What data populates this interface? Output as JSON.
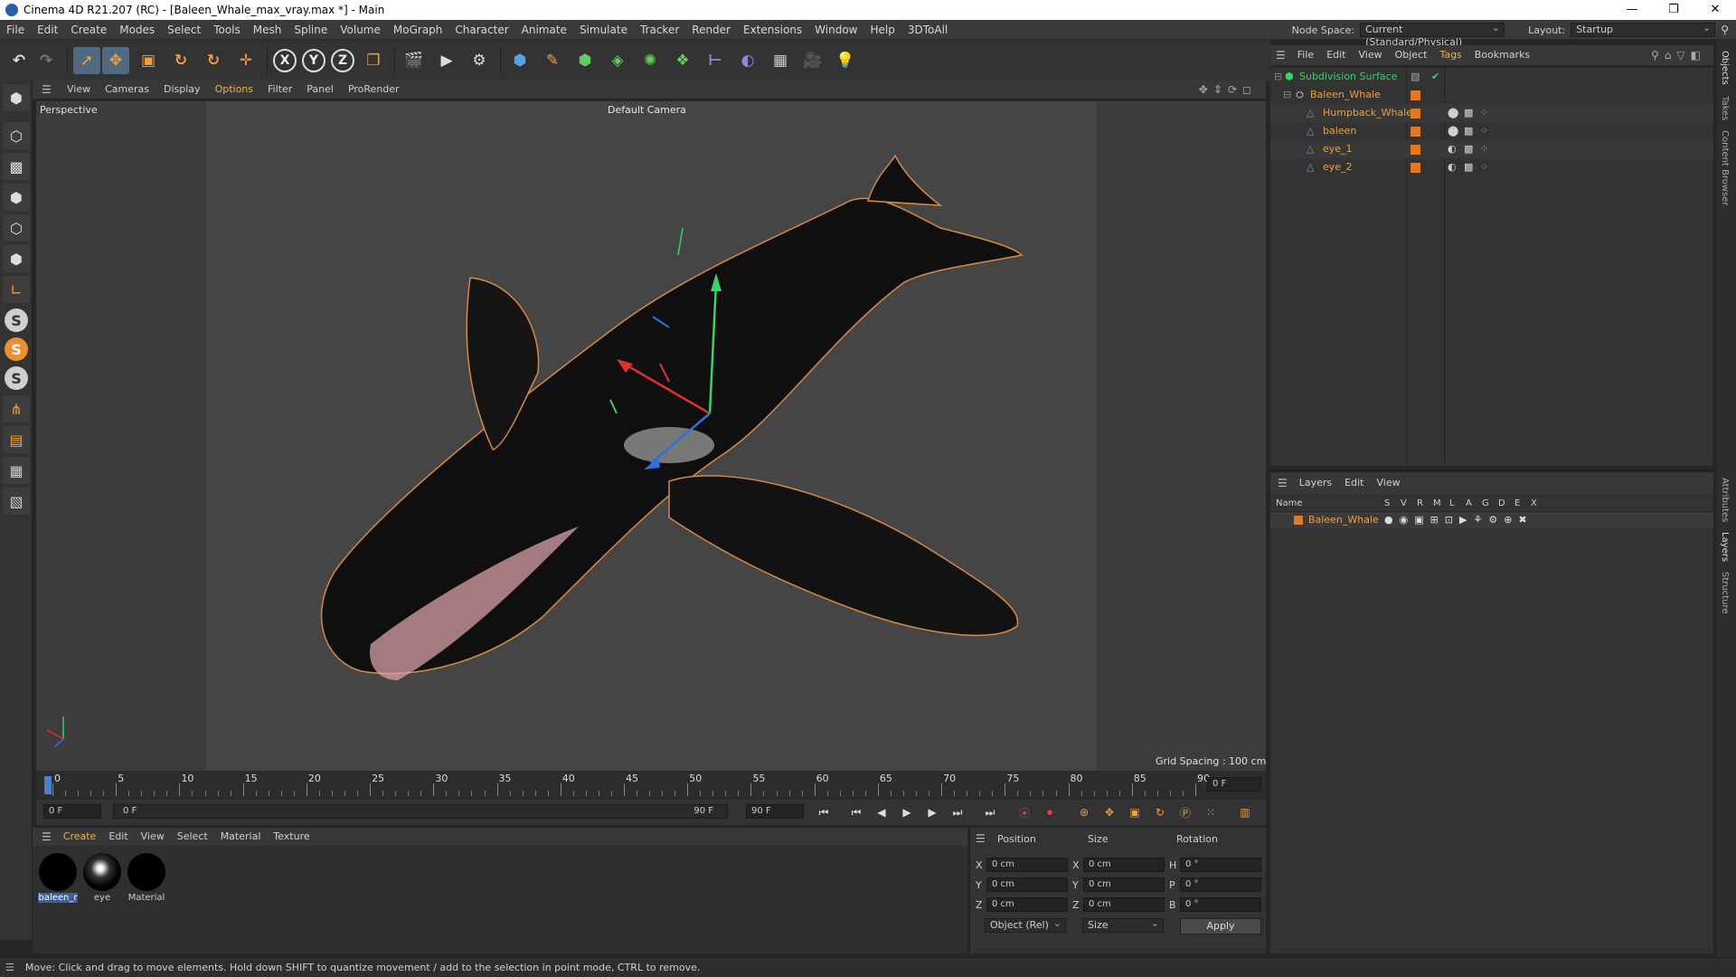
{
  "window": {
    "title": "Cinema 4D R21.207 (RC) - [Baleen_Whale_max_vray.max *] - Main",
    "buttons": [
      "—",
      "❐",
      "✕"
    ]
  },
  "menu": {
    "items": [
      "File",
      "Edit",
      "Create",
      "Modes",
      "Select",
      "Tools",
      "Mesh",
      "Spline",
      "Volume",
      "MoGraph",
      "Character",
      "Animate",
      "Simulate",
      "Tracker",
      "Render",
      "Extensions",
      "Window",
      "Help",
      "3DToAll"
    ],
    "node_space_label": "Node Space:",
    "node_space_value": "Current (Standard/Physical)",
    "layout_label": "Layout:",
    "layout_value": "Startup"
  },
  "toolbar": {
    "axis_x": "X",
    "axis_y": "Y",
    "axis_z": "Z"
  },
  "viewport": {
    "menu": [
      "View",
      "Cameras",
      "Display",
      "Options",
      "Filter",
      "Panel",
      "ProRender"
    ],
    "label": "Perspective",
    "camera": "Default Camera",
    "grid_spacing": "Grid Spacing : 100 cm",
    "colors": {
      "bg": "#3c3c3c",
      "frame": "#454545",
      "outline": "#d88a40"
    }
  },
  "timeline": {
    "ticks": [
      "0",
      "5",
      "10",
      "15",
      "20",
      "25",
      "30",
      "35",
      "40",
      "45",
      "50",
      "55",
      "60",
      "65",
      "70",
      "75",
      "80",
      "85",
      "90"
    ],
    "current_frame": "0 F",
    "start": "0 F",
    "range_start": "0 F",
    "range_end": "90 F",
    "end": "90 F"
  },
  "materials": {
    "menu": [
      "Create",
      "Edit",
      "View",
      "Select",
      "Material",
      "Texture"
    ],
    "items": [
      {
        "label": "baleen_r",
        "selected": true
      },
      {
        "label": "eye",
        "selected": false
      },
      {
        "label": "Material",
        "selected": false
      }
    ]
  },
  "coords": {
    "headers": [
      "Position",
      "Size",
      "Rotation"
    ],
    "position": [
      {
        "axis": "X",
        "value": "0 cm"
      },
      {
        "axis": "Y",
        "value": "0 cm"
      },
      {
        "axis": "Z",
        "value": "0 cm"
      }
    ],
    "size": [
      {
        "axis": "X",
        "value": "0 cm"
      },
      {
        "axis": "Y",
        "value": "0 cm"
      },
      {
        "axis": "Z",
        "value": "0 cm"
      }
    ],
    "rotation": [
      {
        "axis": "H",
        "value": "0 °"
      },
      {
        "axis": "P",
        "value": "0 °"
      },
      {
        "axis": "B",
        "value": "0 °"
      }
    ],
    "mode": "Object (Rel)",
    "size_mode": "Size",
    "apply": "Apply"
  },
  "status": {
    "text": "Move: Click and drag to move elements. Hold down SHIFT to quantize movement / add to the selection in point mode, CTRL to remove."
  },
  "objects": {
    "menu": [
      "File",
      "Edit",
      "View",
      "Object",
      "Tags",
      "Bookmarks"
    ],
    "tree": [
      {
        "name": "Subdivision Surface",
        "level": 0
      },
      {
        "name": "Baleen_Whale",
        "level": 1
      },
      {
        "name": "Humpback_Whale",
        "level": 2
      },
      {
        "name": "baleen",
        "level": 2
      },
      {
        "name": "eye_1",
        "level": 2
      },
      {
        "name": "eye_2",
        "level": 2
      }
    ]
  },
  "layers": {
    "menu": [
      "Layers",
      "Edit",
      "View"
    ],
    "col_name": "Name",
    "cols": [
      "S",
      "V",
      "R",
      "M",
      "L",
      "A",
      "G",
      "D",
      "E",
      "X"
    ],
    "rows": [
      {
        "name": "Baleen_Whale"
      }
    ]
  },
  "side_tabs": [
    "Objects",
    "Takes",
    "Content Browser",
    "Attributes",
    "Layers",
    "Structure"
  ]
}
